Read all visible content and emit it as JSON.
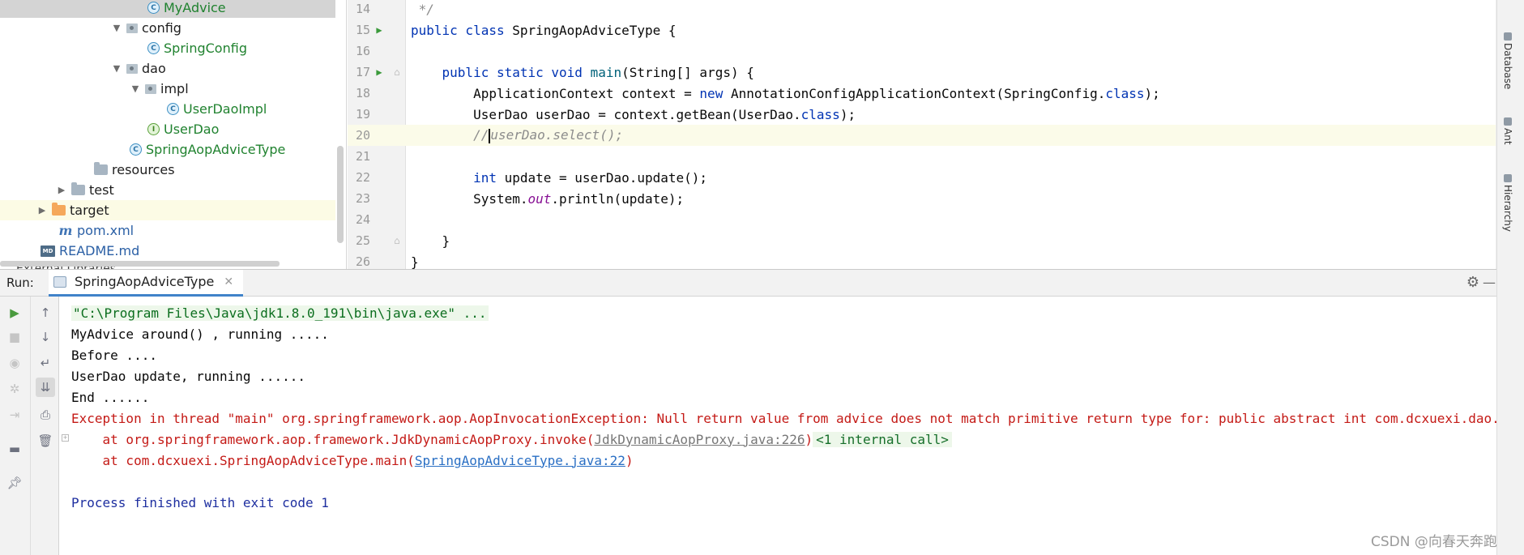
{
  "tree": {
    "items": [
      {
        "label": "MyAdvice",
        "kind": "class"
      },
      {
        "label": "config",
        "kind": "package"
      },
      {
        "label": "SpringConfig",
        "kind": "class"
      },
      {
        "label": "dao",
        "kind": "package"
      },
      {
        "label": "impl",
        "kind": "package"
      },
      {
        "label": "UserDaoImpl",
        "kind": "class"
      },
      {
        "label": "UserDao",
        "kind": "interface"
      },
      {
        "label": "SpringAopAdviceType",
        "kind": "class"
      },
      {
        "label": "resources",
        "kind": "folder"
      },
      {
        "label": "test",
        "kind": "folder"
      },
      {
        "label": "target",
        "kind": "folder"
      },
      {
        "label": "pom.xml",
        "kind": "maven"
      },
      {
        "label": "README.md",
        "kind": "markdown"
      }
    ],
    "class_icon_letter": "C",
    "interface_icon_letter": "I",
    "md_icon_text": "MD",
    "maven_icon_text": "m",
    "external_libraries": "External Libraries"
  },
  "editor": {
    "lines": [
      {
        "num": "14",
        "text": " */"
      },
      {
        "num": "15",
        "text": "public class SpringAopAdviceType {"
      },
      {
        "num": "16",
        "text": ""
      },
      {
        "num": "17",
        "text": "    public static void main(String[] args) {"
      },
      {
        "num": "18",
        "text": "        ApplicationContext context = new AnnotationConfigApplicationContext(SpringConfig.class);"
      },
      {
        "num": "19",
        "text": "        UserDao userDao = context.getBean(UserDao.class);"
      },
      {
        "num": "20",
        "text": "        //userDao.select();"
      },
      {
        "num": "21",
        "text": ""
      },
      {
        "num": "22",
        "text": "        int update = userDao.update();"
      },
      {
        "num": "23",
        "text": "        System.out.println(update);"
      },
      {
        "num": "24",
        "text": ""
      },
      {
        "num": "25",
        "text": "    }"
      },
      {
        "num": "26",
        "text": "}"
      }
    ]
  },
  "side_tabs": [
    "Database",
    "Ant",
    "Hierarchy"
  ],
  "run": {
    "label": "Run:",
    "tab": "SpringAopAdviceType",
    "console": {
      "cmd": "\"C:\\Program Files\\Java\\jdk1.8.0_191\\bin\\java.exe\" ...",
      "l1": "MyAdvice around() , running .....",
      "l2": "Before ....",
      "l3": "UserDao update, running ......",
      "l4": "End ......",
      "err": "Exception in thread \"main\" org.springframework.aop.AopInvocationException: Null return value from advice does not match primitive return type for: public abstract int com.dcxuexi.dao.UserDao.update()",
      "at1_prefix": "    at org.springframework.aop.framework.JdkDynamicAopProxy.invoke(",
      "at1_link": "JdkDynamicAopProxy.java:226",
      "at1_suffix": ")",
      "at1_internal": "<1 internal call>",
      "at2_prefix": "    at com.dcxuexi.SpringAopAdviceType.main(",
      "at2_link": "SpringAopAdviceType.java:22",
      "at2_suffix": ")",
      "exit": "Process finished with exit code 1"
    }
  },
  "watermark": "CSDN @向春天奔跑"
}
